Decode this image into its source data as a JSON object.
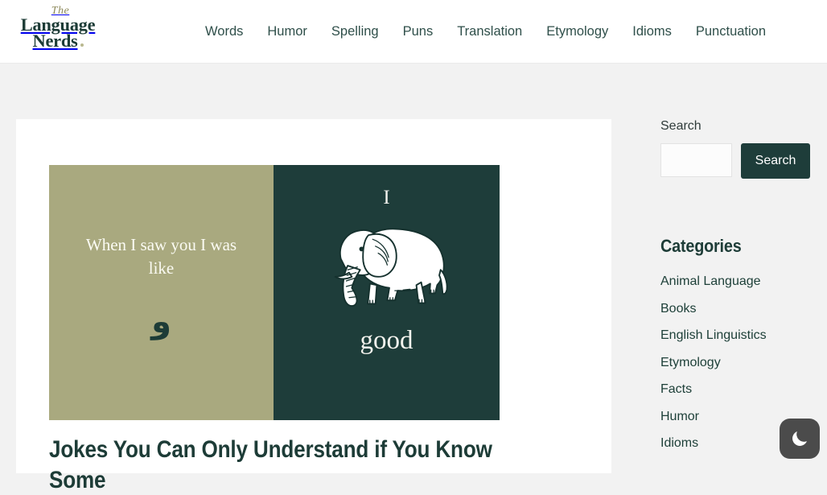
{
  "site": {
    "logo": {
      "line1": "The",
      "line2": "Language",
      "line3": "Nerds"
    }
  },
  "nav": {
    "items": [
      {
        "label": "Words"
      },
      {
        "label": "Humor"
      },
      {
        "label": "Spelling"
      },
      {
        "label": "Puns"
      },
      {
        "label": "Translation"
      },
      {
        "label": "Etymology"
      },
      {
        "label": "Idioms"
      },
      {
        "label": "Punctuation"
      }
    ]
  },
  "article": {
    "title": "Jokes You Can Only Understand if You Know Some",
    "featured_image": {
      "left_panel": {
        "text": "When I saw you I was like",
        "glyph": "و",
        "background": "#a9a97f",
        "text_color": "#fbfbf3"
      },
      "right_panel": {
        "top_text": "I",
        "icon": "elephant-illustration",
        "bottom_text": "good",
        "background": "#1e3d3a",
        "text_color": "#f4f4ee"
      }
    }
  },
  "sidebar": {
    "search": {
      "label": "Search",
      "input_value": "",
      "placeholder": "",
      "button_label": "Search"
    },
    "categories": {
      "title": "Categories",
      "items": [
        {
          "label": "Animal Language"
        },
        {
          "label": "Books"
        },
        {
          "label": "English Linguistics"
        },
        {
          "label": "Etymology"
        },
        {
          "label": "Facts"
        },
        {
          "label": "Humor"
        },
        {
          "label": "Idioms"
        }
      ]
    }
  },
  "dark_mode_toggle": {
    "icon": "moon-icon",
    "background": "#4b4b4b"
  },
  "colors": {
    "brand_dark_teal": "#1e3d3a",
    "brand_olive": "#a9a97f",
    "page_background": "#f2f2f2",
    "card_background": "#ffffff",
    "nav_text": "#2f4f4a"
  }
}
